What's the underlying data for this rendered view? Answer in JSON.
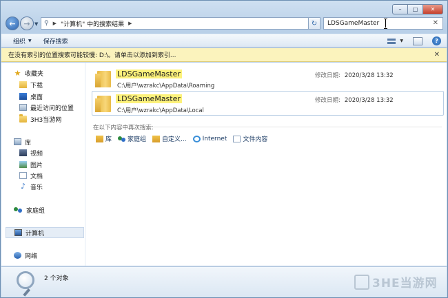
{
  "window": {
    "controls": [
      "–",
      "□",
      "✕"
    ]
  },
  "address": {
    "crumbs": [
      "\"计算机\" 中的搜索结果"
    ]
  },
  "search": {
    "value": "LDSGameMaster"
  },
  "toolbar": {
    "organize": "组织",
    "save_search": "保存搜索"
  },
  "infobar": {
    "text": "在没有索引的位置搜索可能较慢: D:\\。请单击以添加到索引..."
  },
  "nav": {
    "favorites": "收藏夹",
    "downloads": "下载",
    "desktop": "桌面",
    "recent": "最近访问的位置",
    "site": "3H3当游网",
    "libraries": "库",
    "videos": "视频",
    "pictures": "图片",
    "documents": "文档",
    "music": "音乐",
    "homegroup": "家庭组",
    "computer": "计算机",
    "network": "网络"
  },
  "results": [
    {
      "name": "LDSGameMaster",
      "path": "C:\\用户\\wzrakc\\AppData\\Roaming",
      "date_label": "修改日期:",
      "date": "2020/3/28 13:32"
    },
    {
      "name": "LDSGameMaster",
      "path": "C:\\用户\\wzrakc\\AppData\\Local",
      "date_label": "修改日期:",
      "date": "2020/3/28 13:32"
    }
  ],
  "search_again": {
    "label": "在以下内容中再次搜索:",
    "items": [
      "库",
      "家庭组",
      "自定义...",
      "Internet",
      "文件内容"
    ]
  },
  "status": {
    "count": "2 个对象"
  },
  "watermark": "3HE当游网"
}
